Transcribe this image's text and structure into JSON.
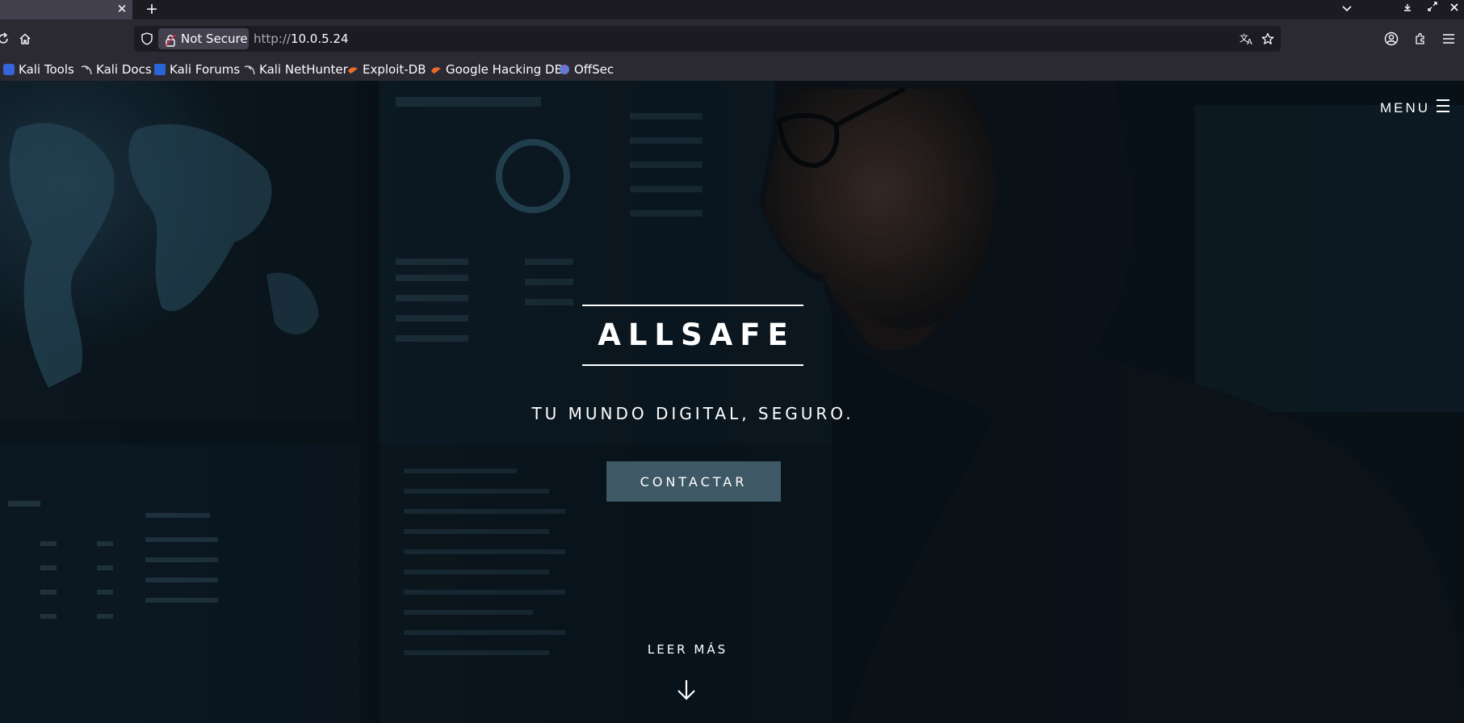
{
  "browser": {
    "tab": {
      "close_label": "✕",
      "new_tab_label": "+"
    },
    "security_label": "Not Secure",
    "url_prefix": "http://",
    "url_host": "10.0.5.24",
    "bookmarks": [
      {
        "label": "Kali Tools",
        "icon": "kali-tools-icon"
      },
      {
        "label": "Kali Docs",
        "icon": "kali-dragon-icon"
      },
      {
        "label": "Kali Forums",
        "icon": "kali-forums-icon"
      },
      {
        "label": "Kali NetHunter",
        "icon": "kali-dragon-icon"
      },
      {
        "label": "Exploit-DB",
        "icon": "exploit-db-icon"
      },
      {
        "label": "Google Hacking DB",
        "icon": "exploit-db-icon"
      },
      {
        "label": "OffSec",
        "icon": "offsec-icon"
      }
    ]
  },
  "page": {
    "menu_label": "MENU",
    "brand": "ALLSAFE",
    "tagline": "TU MUNDO DIGITAL, SEGURO.",
    "cta_label": "CONTACTAR",
    "read_more_label": "LEER MÁS"
  },
  "colors": {
    "cta_bg": "#3e5866",
    "chrome_dark": "#1c1b22",
    "chrome_toolbar": "#2b2a33"
  }
}
